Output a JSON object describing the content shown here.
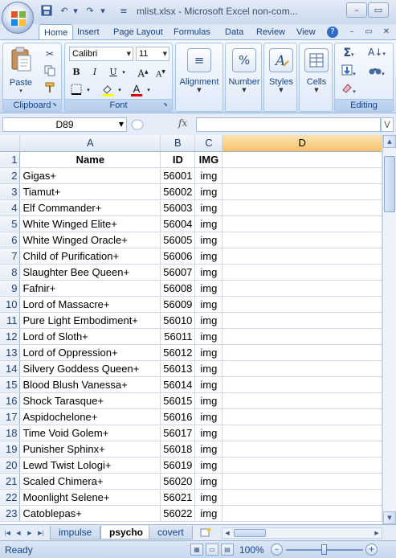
{
  "window": {
    "title": "mlist.xlsx - Microsoft Excel non-com...",
    "minimize_glyph": "–",
    "maximize_glyph": "▭",
    "close_glyph": "✕"
  },
  "quick_access": {
    "save_icon": "save-icon",
    "undo_icon": "undo-icon",
    "redo_icon": "redo-icon"
  },
  "ribbon_tabs": [
    "Home",
    "Insert",
    "Page Layout",
    "Formulas",
    "Data",
    "Review",
    "View"
  ],
  "active_tab": "Home",
  "ribbon": {
    "clipboard": {
      "label": "Clipboard",
      "paste_label": "Paste"
    },
    "font": {
      "label": "Font",
      "font_name": "Calibri",
      "font_size": "11",
      "bold": "B",
      "italic": "I",
      "underline": "U",
      "grow": "A",
      "shrink": "A",
      "font_color_letter": "A"
    },
    "alignment": {
      "label": "Alignment"
    },
    "number": {
      "label": "Number",
      "icon_glyph": "%"
    },
    "styles": {
      "label": "Styles"
    },
    "cells": {
      "label": "Cells"
    },
    "editing": {
      "label": "Editing",
      "sum_glyph": "Σ"
    }
  },
  "formula_bar": {
    "name_box": "D89",
    "fx_label": "fx",
    "formula": ""
  },
  "sheet": {
    "column_headers": [
      "A",
      "B",
      "C",
      "D"
    ],
    "active_column": "D",
    "row_numbers": [
      "1",
      "2",
      "3",
      "4",
      "5",
      "6",
      "7",
      "8",
      "9",
      "10",
      "11",
      "12",
      "13",
      "14",
      "15",
      "16",
      "17",
      "18",
      "19",
      "20",
      "21",
      "22",
      "23"
    ],
    "header_row": [
      "Name",
      "ID",
      "IMG"
    ],
    "rows": [
      [
        "Gigas+",
        "56001",
        "img"
      ],
      [
        "Tiamut+",
        "56002",
        "img"
      ],
      [
        "Elf Commander+",
        "56003",
        "img"
      ],
      [
        "White Winged Elite+",
        "56004",
        "img"
      ],
      [
        "White Winged Oracle+",
        "56005",
        "img"
      ],
      [
        "Child of Purification+",
        "56006",
        "img"
      ],
      [
        "Slaughter Bee Queen+",
        "56007",
        "img"
      ],
      [
        "Fafnir+",
        "56008",
        "img"
      ],
      [
        "Lord of Massacre+",
        "56009",
        "img"
      ],
      [
        "Pure Light Embodiment+",
        "56010",
        "img"
      ],
      [
        "Lord of Sloth+",
        "56011",
        "img"
      ],
      [
        "Lord of Oppression+",
        "56012",
        "img"
      ],
      [
        "Silvery Goddess Queen+",
        "56013",
        "img"
      ],
      [
        "Blood Blush Vanessa+",
        "56014",
        "img"
      ],
      [
        "Shock Tarasque+",
        "56015",
        "img"
      ],
      [
        "Aspidochelone+",
        "56016",
        "img"
      ],
      [
        "Time Void Golem+",
        "56017",
        "img"
      ],
      [
        "Punisher Sphinx+",
        "56018",
        "img"
      ],
      [
        "Lewd Twist Lologi+",
        "56019",
        "img"
      ],
      [
        "Scaled Chimera+",
        "56020",
        "img"
      ],
      [
        "Moonlight Selene+",
        "56021",
        "img"
      ],
      [
        "Catoblepas+",
        "56022",
        "img"
      ]
    ]
  },
  "sheet_tabs": [
    "impulse",
    "psycho",
    "covert"
  ],
  "active_sheet": "psycho",
  "status": {
    "text": "Ready",
    "zoom": "100%",
    "zoom_fraction": 0.5
  }
}
